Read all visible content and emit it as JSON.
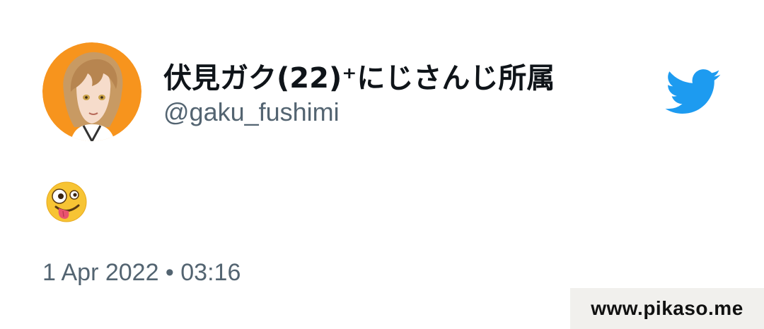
{
  "tweet": {
    "display_name": "伏見ガク(22)⁺にじさんじ所属",
    "handle": "@gaku_fushimi",
    "content_emoji": "🤪",
    "timestamp": "1 Apr 2022 • 03:16"
  },
  "avatar": {
    "description_icon": "avatar-icon",
    "background_color": "#f7941d"
  },
  "brand": {
    "logo_icon": "twitter-bird-icon",
    "color": "#1d9bf0"
  },
  "watermark": {
    "text": "www.pikaso.me"
  }
}
